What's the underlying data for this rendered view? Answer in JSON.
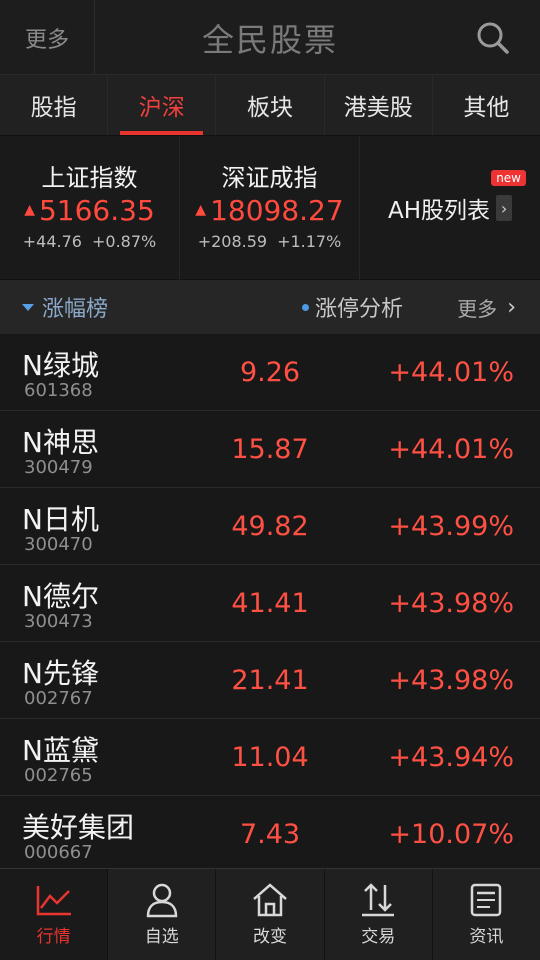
{
  "header": {
    "more_label": "更多",
    "title": "全民股票"
  },
  "tabs": [
    {
      "label": "股指"
    },
    {
      "label": "沪深"
    },
    {
      "label": "板块"
    },
    {
      "label": "港美股"
    },
    {
      "label": "其他"
    }
  ],
  "indices": [
    {
      "name": "上证指数",
      "value": "5166.35",
      "change": "+44.76",
      "percent": "+0.87%"
    },
    {
      "name": "深证成指",
      "value": "18098.27",
      "change": "+208.59",
      "percent": "+1.17%"
    }
  ],
  "ah": {
    "label": "AH股列表",
    "badge": "new"
  },
  "rank_header": {
    "title": "涨幅榜",
    "analysis": "涨停分析",
    "more": "更多"
  },
  "stocks": [
    {
      "name": "N绿城",
      "code": "601368",
      "price": "9.26",
      "percent": "+44.01%"
    },
    {
      "name": "N神思",
      "code": "300479",
      "price": "15.87",
      "percent": "+44.01%"
    },
    {
      "name": "N日机",
      "code": "300470",
      "price": "49.82",
      "percent": "+43.99%"
    },
    {
      "name": "N德尔",
      "code": "300473",
      "price": "41.41",
      "percent": "+43.98%"
    },
    {
      "name": "N先锋",
      "code": "002767",
      "price": "21.41",
      "percent": "+43.98%"
    },
    {
      "name": "N蓝黛",
      "code": "002765",
      "price": "11.04",
      "percent": "+43.94%"
    },
    {
      "name": "美好集团",
      "code": "000667",
      "price": "7.43",
      "percent": "+10.07%"
    }
  ],
  "bottom_nav": [
    {
      "label": "行情",
      "icon": "chart-line-icon"
    },
    {
      "label": "自选",
      "icon": "person-icon"
    },
    {
      "label": "改变",
      "icon": "home-icon"
    },
    {
      "label": "交易",
      "icon": "transfer-icon"
    },
    {
      "label": "资讯",
      "icon": "news-icon"
    }
  ],
  "colors": {
    "accent": "#e8352f",
    "up": "#ff5044",
    "background": "#171717"
  }
}
